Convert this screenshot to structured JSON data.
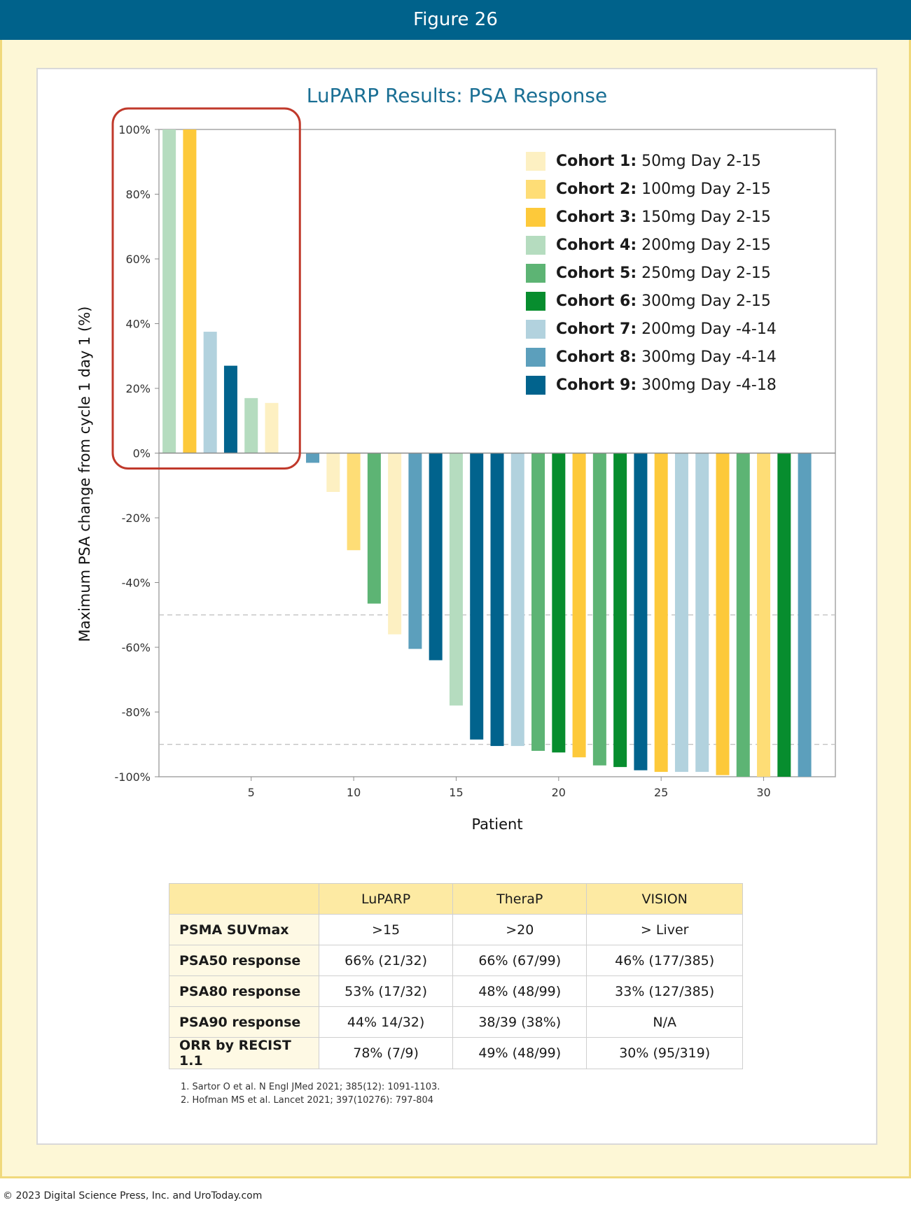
{
  "header": {
    "title": "Figure 26"
  },
  "chart_data": {
    "type": "bar",
    "title": "LuPARP Results: PSA Response",
    "xlabel": "Patient",
    "ylabel": "Maximum PSA change from cycle 1 day 1 (%)",
    "ylim": [
      -100,
      100
    ],
    "xlim": [
      0.5,
      33.5
    ],
    "x_ticks": [
      5,
      10,
      15,
      20,
      25,
      30
    ],
    "y_ticks": [
      {
        "value": 100,
        "label": "100%"
      },
      {
        "value": 80,
        "label": "80%"
      },
      {
        "value": 60,
        "label": "60%"
      },
      {
        "value": 40,
        "label": "40%"
      },
      {
        "value": 20,
        "label": "20%"
      },
      {
        "value": 0,
        "label": "0%"
      },
      {
        "value": -20,
        "label": "-20%"
      },
      {
        "value": -40,
        "label": "-40%"
      },
      {
        "value": -60,
        "label": "-60%"
      },
      {
        "value": -80,
        "label": "-80%"
      },
      {
        "value": -100,
        "label": "-100%"
      }
    ],
    "reference_lines": [
      -50,
      -90
    ],
    "highlight_box": {
      "from_patient": 1,
      "to_patient": 7,
      "color": "#c0392b"
    },
    "legend_position": "top-right",
    "legend": [
      {
        "cohort": "Cohort 1:",
        "desc": "50mg Day 2-15",
        "color": "#fdf0c2"
      },
      {
        "cohort": "Cohort 2:",
        "desc": "100mg Day 2-15",
        "color": "#fedd76"
      },
      {
        "cohort": "Cohort 3:",
        "desc": "150mg Day 2-15",
        "color": "#fdc93a"
      },
      {
        "cohort": "Cohort 4:",
        "desc": "200mg Day 2-15",
        "color": "#b5dcbf"
      },
      {
        "cohort": "Cohort 5:",
        "desc": "250mg Day 2-15",
        "color": "#5db474"
      },
      {
        "cohort": "Cohort 6:",
        "desc": "300mg Day 2-15",
        "color": "#078d2e"
      },
      {
        "cohort": "Cohort 7:",
        "desc": "200mg Day -4-14",
        "color": "#b2d2de"
      },
      {
        "cohort": "Cohort 8:",
        "desc": "300mg Day -4-14",
        "color": "#5c9fbc"
      },
      {
        "cohort": "Cohort 9:",
        "desc": "300mg Day -4-18",
        "color": "#01638d"
      }
    ],
    "bars": [
      {
        "patient": 1,
        "value": 100,
        "cohort": 4
      },
      {
        "patient": 2,
        "value": 100,
        "cohort": 3
      },
      {
        "patient": 3,
        "value": 37.5,
        "cohort": 7
      },
      {
        "patient": 4,
        "value": 27,
        "cohort": 9
      },
      {
        "patient": 5,
        "value": 17,
        "cohort": 4
      },
      {
        "patient": 6,
        "value": 15.5,
        "cohort": 1
      },
      {
        "patient": 8,
        "value": -3,
        "cohort": 8
      },
      {
        "patient": 9,
        "value": -12,
        "cohort": 1
      },
      {
        "patient": 10,
        "value": -30,
        "cohort": 2
      },
      {
        "patient": 11,
        "value": -46.5,
        "cohort": 5
      },
      {
        "patient": 12,
        "value": -56,
        "cohort": 1
      },
      {
        "patient": 13,
        "value": -60.5,
        "cohort": 8
      },
      {
        "patient": 14,
        "value": -64,
        "cohort": 9
      },
      {
        "patient": 15,
        "value": -78,
        "cohort": 4
      },
      {
        "patient": 16,
        "value": -88.5,
        "cohort": 9
      },
      {
        "patient": 17,
        "value": -90.5,
        "cohort": 9
      },
      {
        "patient": 18,
        "value": -90.5,
        "cohort": 7
      },
      {
        "patient": 19,
        "value": -92,
        "cohort": 5
      },
      {
        "patient": 20,
        "value": -92.5,
        "cohort": 6
      },
      {
        "patient": 21,
        "value": -94,
        "cohort": 3
      },
      {
        "patient": 22,
        "value": -96.5,
        "cohort": 5
      },
      {
        "patient": 23,
        "value": -97,
        "cohort": 6
      },
      {
        "patient": 24,
        "value": -98,
        "cohort": 9
      },
      {
        "patient": 25,
        "value": -98.5,
        "cohort": 3
      },
      {
        "patient": 26,
        "value": -98.5,
        "cohort": 7
      },
      {
        "patient": 27,
        "value": -98.5,
        "cohort": 7
      },
      {
        "patient": 28,
        "value": -99.5,
        "cohort": 3
      },
      {
        "patient": 29,
        "value": -100,
        "cohort": 5
      },
      {
        "patient": 30,
        "value": -100,
        "cohort": 2
      },
      {
        "patient": 31,
        "value": -100,
        "cohort": 6
      },
      {
        "patient": 32,
        "value": -100,
        "cohort": 8
      }
    ]
  },
  "table": {
    "columns": [
      "",
      "LuPARP",
      "TheraP",
      "VISION"
    ],
    "rows": [
      {
        "label": "PSMA SUVmax",
        "values": [
          ">15",
          ">20",
          "> Liver"
        ]
      },
      {
        "label": "PSA50 response",
        "values": [
          "66% (21/32)",
          "66% (67/99)",
          "46% (177/385)"
        ]
      },
      {
        "label": "PSA80 response",
        "values": [
          "53% (17/32)",
          "48% (48/99)",
          "33% (127/385)"
        ]
      },
      {
        "label": "PSA90 response",
        "values": [
          "44% 14/32)",
          "38/39 (38%)",
          "N/A"
        ]
      },
      {
        "label": "ORR by RECIST 1.1",
        "values": [
          "78% (7/9)",
          "49% (48/99)",
          "30% (95/319)"
        ]
      }
    ]
  },
  "references": [
    "1. Sartor O et al. N Engl JMed 2021; 385(12): 1091-1103.",
    "2. Hofman MS et al. Lancet 2021; 397(10276): 797-804"
  ],
  "copyright": "© 2023 Digital Science Press, Inc. and UroToday.com"
}
